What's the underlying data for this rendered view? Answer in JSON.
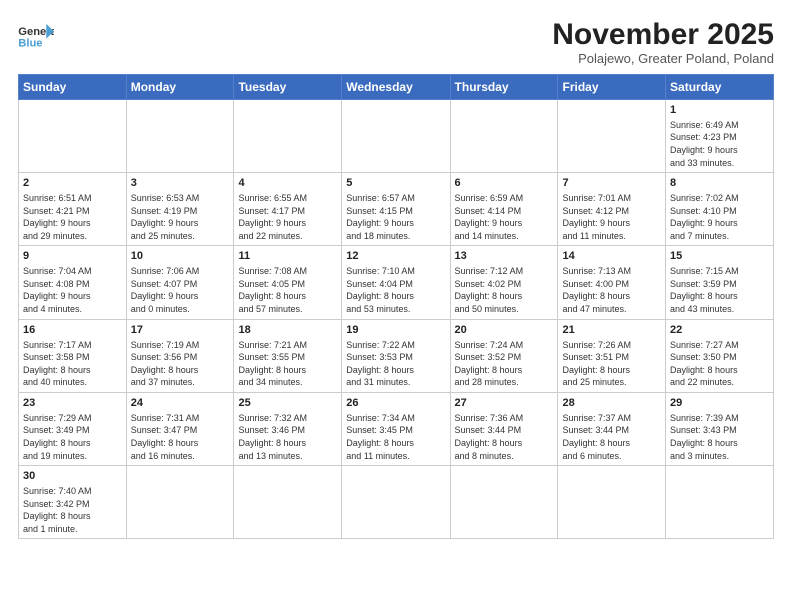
{
  "header": {
    "logo_general": "General",
    "logo_blue": "Blue",
    "title": "November 2025",
    "subtitle": "Polajewo, Greater Poland, Poland"
  },
  "days_of_week": [
    "Sunday",
    "Monday",
    "Tuesday",
    "Wednesday",
    "Thursday",
    "Friday",
    "Saturday"
  ],
  "weeks": [
    [
      {
        "num": "",
        "info": ""
      },
      {
        "num": "",
        "info": ""
      },
      {
        "num": "",
        "info": ""
      },
      {
        "num": "",
        "info": ""
      },
      {
        "num": "",
        "info": ""
      },
      {
        "num": "",
        "info": ""
      },
      {
        "num": "1",
        "info": "Sunrise: 6:49 AM\nSunset: 4:23 PM\nDaylight: 9 hours\nand 33 minutes."
      }
    ],
    [
      {
        "num": "2",
        "info": "Sunrise: 6:51 AM\nSunset: 4:21 PM\nDaylight: 9 hours\nand 29 minutes."
      },
      {
        "num": "3",
        "info": "Sunrise: 6:53 AM\nSunset: 4:19 PM\nDaylight: 9 hours\nand 25 minutes."
      },
      {
        "num": "4",
        "info": "Sunrise: 6:55 AM\nSunset: 4:17 PM\nDaylight: 9 hours\nand 22 minutes."
      },
      {
        "num": "5",
        "info": "Sunrise: 6:57 AM\nSunset: 4:15 PM\nDaylight: 9 hours\nand 18 minutes."
      },
      {
        "num": "6",
        "info": "Sunrise: 6:59 AM\nSunset: 4:14 PM\nDaylight: 9 hours\nand 14 minutes."
      },
      {
        "num": "7",
        "info": "Sunrise: 7:01 AM\nSunset: 4:12 PM\nDaylight: 9 hours\nand 11 minutes."
      },
      {
        "num": "8",
        "info": "Sunrise: 7:02 AM\nSunset: 4:10 PM\nDaylight: 9 hours\nand 7 minutes."
      }
    ],
    [
      {
        "num": "9",
        "info": "Sunrise: 7:04 AM\nSunset: 4:08 PM\nDaylight: 9 hours\nand 4 minutes."
      },
      {
        "num": "10",
        "info": "Sunrise: 7:06 AM\nSunset: 4:07 PM\nDaylight: 9 hours\nand 0 minutes."
      },
      {
        "num": "11",
        "info": "Sunrise: 7:08 AM\nSunset: 4:05 PM\nDaylight: 8 hours\nand 57 minutes."
      },
      {
        "num": "12",
        "info": "Sunrise: 7:10 AM\nSunset: 4:04 PM\nDaylight: 8 hours\nand 53 minutes."
      },
      {
        "num": "13",
        "info": "Sunrise: 7:12 AM\nSunset: 4:02 PM\nDaylight: 8 hours\nand 50 minutes."
      },
      {
        "num": "14",
        "info": "Sunrise: 7:13 AM\nSunset: 4:00 PM\nDaylight: 8 hours\nand 47 minutes."
      },
      {
        "num": "15",
        "info": "Sunrise: 7:15 AM\nSunset: 3:59 PM\nDaylight: 8 hours\nand 43 minutes."
      }
    ],
    [
      {
        "num": "16",
        "info": "Sunrise: 7:17 AM\nSunset: 3:58 PM\nDaylight: 8 hours\nand 40 minutes."
      },
      {
        "num": "17",
        "info": "Sunrise: 7:19 AM\nSunset: 3:56 PM\nDaylight: 8 hours\nand 37 minutes."
      },
      {
        "num": "18",
        "info": "Sunrise: 7:21 AM\nSunset: 3:55 PM\nDaylight: 8 hours\nand 34 minutes."
      },
      {
        "num": "19",
        "info": "Sunrise: 7:22 AM\nSunset: 3:53 PM\nDaylight: 8 hours\nand 31 minutes."
      },
      {
        "num": "20",
        "info": "Sunrise: 7:24 AM\nSunset: 3:52 PM\nDaylight: 8 hours\nand 28 minutes."
      },
      {
        "num": "21",
        "info": "Sunrise: 7:26 AM\nSunset: 3:51 PM\nDaylight: 8 hours\nand 25 minutes."
      },
      {
        "num": "22",
        "info": "Sunrise: 7:27 AM\nSunset: 3:50 PM\nDaylight: 8 hours\nand 22 minutes."
      }
    ],
    [
      {
        "num": "23",
        "info": "Sunrise: 7:29 AM\nSunset: 3:49 PM\nDaylight: 8 hours\nand 19 minutes."
      },
      {
        "num": "24",
        "info": "Sunrise: 7:31 AM\nSunset: 3:47 PM\nDaylight: 8 hours\nand 16 minutes."
      },
      {
        "num": "25",
        "info": "Sunrise: 7:32 AM\nSunset: 3:46 PM\nDaylight: 8 hours\nand 13 minutes."
      },
      {
        "num": "26",
        "info": "Sunrise: 7:34 AM\nSunset: 3:45 PM\nDaylight: 8 hours\nand 11 minutes."
      },
      {
        "num": "27",
        "info": "Sunrise: 7:36 AM\nSunset: 3:44 PM\nDaylight: 8 hours\nand 8 minutes."
      },
      {
        "num": "28",
        "info": "Sunrise: 7:37 AM\nSunset: 3:44 PM\nDaylight: 8 hours\nand 6 minutes."
      },
      {
        "num": "29",
        "info": "Sunrise: 7:39 AM\nSunset: 3:43 PM\nDaylight: 8 hours\nand 3 minutes."
      }
    ],
    [
      {
        "num": "30",
        "info": "Sunrise: 7:40 AM\nSunset: 3:42 PM\nDaylight: 8 hours\nand 1 minute."
      },
      {
        "num": "",
        "info": ""
      },
      {
        "num": "",
        "info": ""
      },
      {
        "num": "",
        "info": ""
      },
      {
        "num": "",
        "info": ""
      },
      {
        "num": "",
        "info": ""
      },
      {
        "num": "",
        "info": ""
      }
    ]
  ]
}
